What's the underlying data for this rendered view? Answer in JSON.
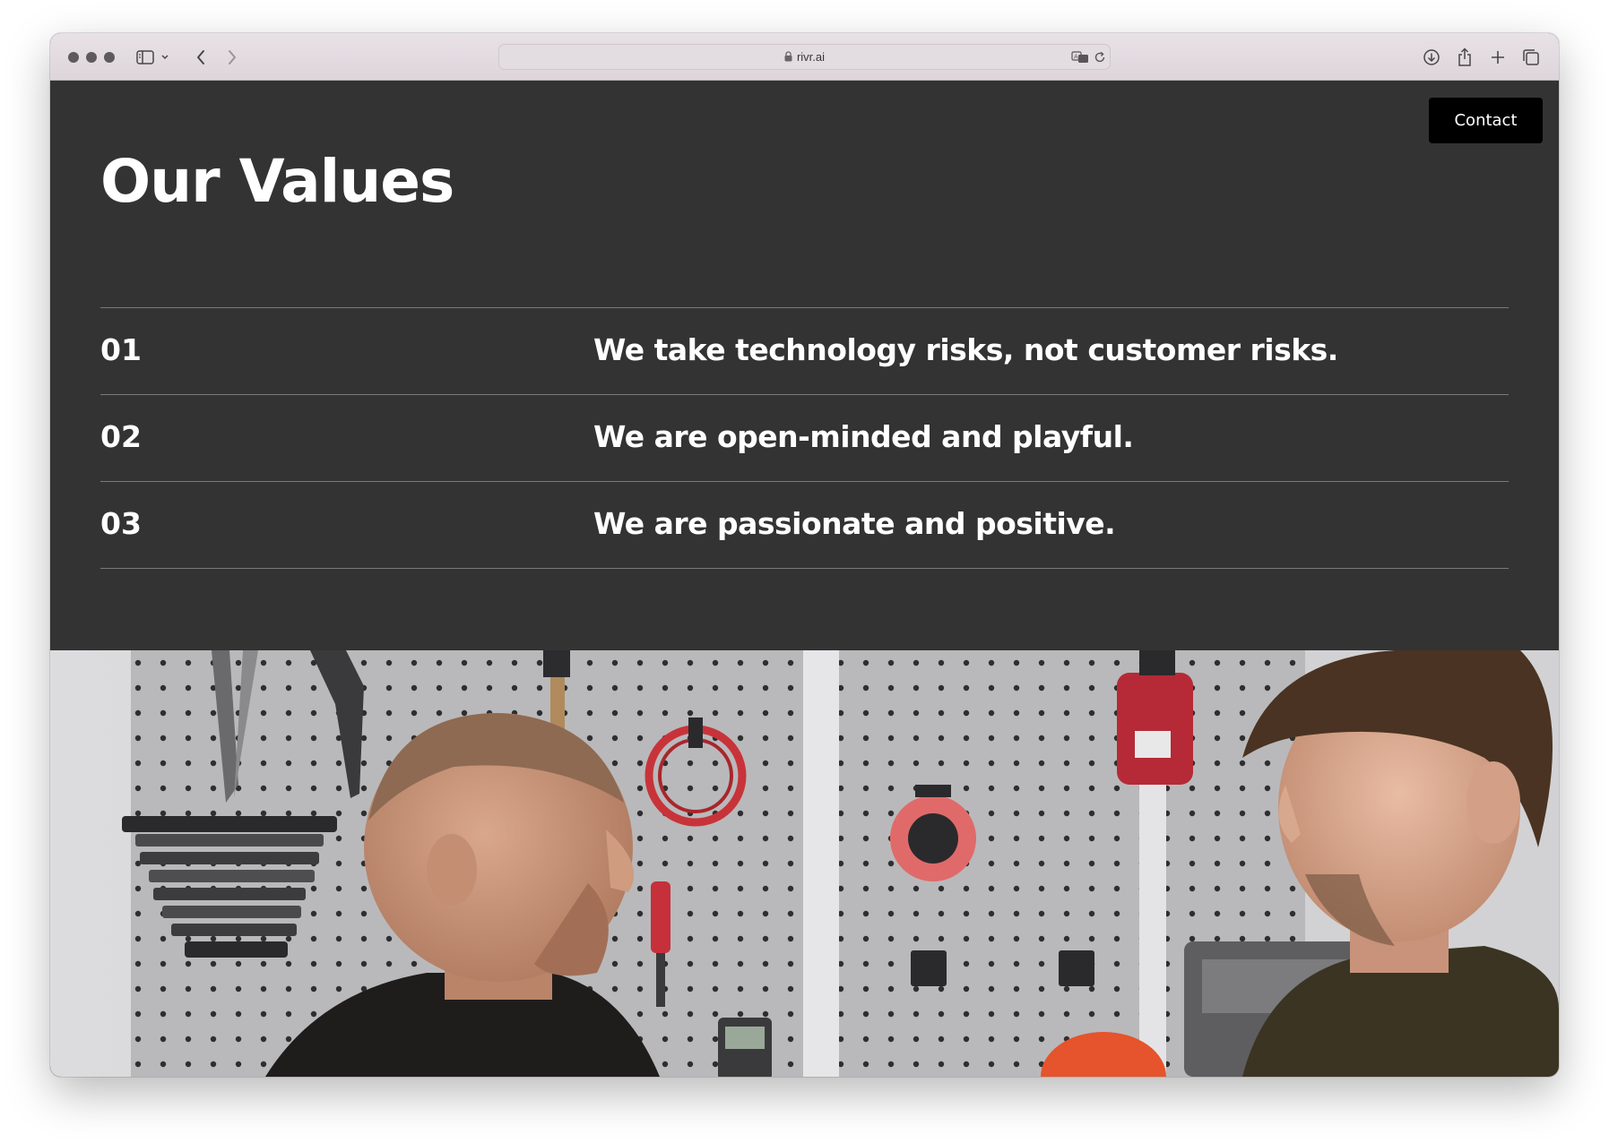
{
  "browser": {
    "url": "rivr.ai",
    "icons": {
      "sidebar": "sidebar-icon",
      "back": "chevron-left-icon",
      "forward": "chevron-right-icon",
      "lock": "lock-icon",
      "translate": "translate-icon",
      "reload": "reload-icon",
      "download": "download-icon",
      "share": "share-icon",
      "new_tab": "plus-icon",
      "tabs": "tabs-overview-icon"
    }
  },
  "header": {
    "contact_label": "Contact"
  },
  "main": {
    "title": "Our Values",
    "values": [
      {
        "number": "01",
        "text": "We take technology risks, not customer risks."
      },
      {
        "number": "02",
        "text": "We are open-minded and playful."
      },
      {
        "number": "03",
        "text": "We are passionate and positive."
      }
    ]
  },
  "colors": {
    "page_background": "#333333",
    "text": "#ffffff",
    "divider": "#7a7a7a",
    "button_background": "#000000"
  }
}
